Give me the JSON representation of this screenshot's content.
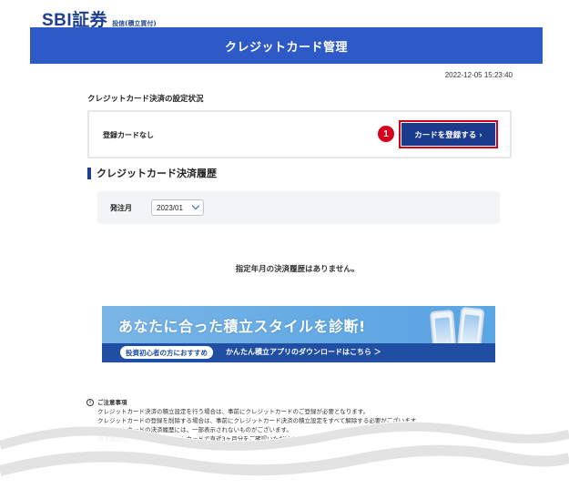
{
  "header": {
    "logo": "SBI証券",
    "logo_sub": "投信(積立買付)",
    "title": "クレジットカード管理",
    "timestamp": "2022-12-05 15:23:40"
  },
  "settings": {
    "heading": "クレジットカード決済の設定状況",
    "status": "登録カードなし",
    "step_number": "1",
    "register_button": "カードを登録する ›"
  },
  "history": {
    "heading": "クレジットカード決済履歴",
    "filter_label": "発注月",
    "month_value": "2023/01",
    "empty_message": "指定年月の決済履歴はありません。"
  },
  "promo": {
    "headline": "あなたに合った積立スタイルを診断!",
    "pill": "投資初心者の方におすすめ",
    "cta": "かんたん積立アプリのダウンロードはこちら ＞"
  },
  "notes": {
    "title": "ご注意事項",
    "lines": [
      "クレジットカード決済の積立設定を行う場合は、事前にクレジットカードのご登録が必要となります。",
      "クレジットカードの登録を削除する場合は、事前にクレジットカード決済の積立設定をすべて解除する必要がございます。",
      "クレジットカードの決済履歴には、一部表示されないものがございます。",
      "決済履歴は、ご登録のクレジットカードで直近3ヶ月分をご確認いただけます。"
    ]
  },
  "colors": {
    "brand": "#1c3f91",
    "banner": "#2d5ac7",
    "highlight": "#d6001c"
  }
}
